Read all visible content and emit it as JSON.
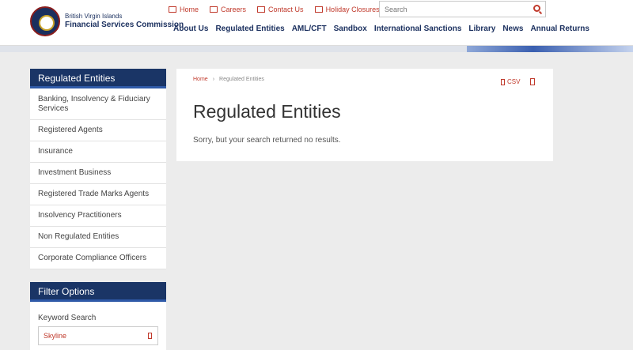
{
  "logo": {
    "line1": "British Virgin Islands",
    "line2": "Financial Services Commission"
  },
  "utility_links": [
    {
      "label": "Home",
      "icon": "home-icon"
    },
    {
      "label": "Careers",
      "icon": "briefcase-icon"
    },
    {
      "label": "Contact Us",
      "icon": "mail-icon"
    },
    {
      "label": "Holiday Closures",
      "icon": "calendar-icon"
    }
  ],
  "search": {
    "placeholder": "Search"
  },
  "main_nav": [
    "About Us",
    "Regulated Entities",
    "AML/CFT",
    "Sandbox",
    "International Sanctions",
    "Library",
    "News",
    "Annual Returns"
  ],
  "sidebar": {
    "title": "Regulated Entities",
    "items": [
      "Banking, Insolvency & Fiduciary Services",
      "Registered Agents",
      "Insurance",
      "Investment Business",
      "Registered Trade Marks Agents",
      "Insolvency Practitioners",
      "Non Regulated Entities",
      "Corporate Compliance Officers"
    ]
  },
  "filter": {
    "title": "Filter Options",
    "keyword_label": "Keyword Search",
    "keyword_value": "Skyline"
  },
  "content": {
    "breadcrumb": [
      "Home",
      "Regulated Entities"
    ],
    "breadcrumb_sep": "›",
    "csv_label": "CSV",
    "title": "Regulated Entities",
    "message": "Sorry, but your search returned no results."
  },
  "colors": {
    "brand_navy": "#1a3566",
    "accent_red": "#c0392b"
  }
}
